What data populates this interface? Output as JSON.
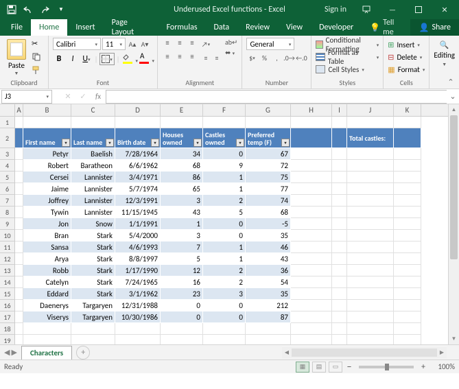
{
  "title": "Underused Excel functions - Excel",
  "signin": "Sign in",
  "tabs": {
    "file": "File",
    "home": "Home",
    "insert": "Insert",
    "pagelayout": "Page Layout",
    "formulas": "Formulas",
    "data": "Data",
    "review": "Review",
    "view": "View",
    "developer": "Developer",
    "tellme": "Tell me",
    "share": "Share"
  },
  "ribbon": {
    "clipboard": {
      "paste": "Paste",
      "label": "Clipboard"
    },
    "font": {
      "name": "Calibri",
      "size": "11",
      "label": "Font"
    },
    "alignment": {
      "label": "Alignment"
    },
    "number": {
      "format": "General",
      "label": "Number"
    },
    "styles": {
      "conditional": "Conditional Formatting",
      "table": "Format as Table",
      "cellstyles": "Cell Styles",
      "label": "Styles"
    },
    "cells": {
      "insert": "Insert",
      "delete": "Delete",
      "format": "Format",
      "label": "Cells"
    },
    "editing": {
      "label": "Editing"
    }
  },
  "namebox": "J3",
  "formula": "",
  "columns": [
    "A",
    "B",
    "C",
    "D",
    "E",
    "F",
    "G",
    "H",
    "I",
    "J",
    "K"
  ],
  "rows": [
    "1",
    "2",
    "3",
    "4",
    "5",
    "6",
    "7",
    "8",
    "9",
    "10",
    "11",
    "12",
    "13",
    "14",
    "15",
    "16",
    "17",
    "18",
    "19"
  ],
  "extra_label": "Total castles:",
  "table": {
    "headers": [
      "First name",
      "Last name",
      "Birth date",
      "Houses owned",
      "Castles owned",
      "Preferred temp (F)"
    ],
    "rows": [
      {
        "first": "Petyr",
        "last": "Baelish",
        "birth": "7/28/1964",
        "houses": "34",
        "castles": "0",
        "temp": "67"
      },
      {
        "first": "Robert",
        "last": "Baratheon",
        "birth": "6/6/1962",
        "houses": "68",
        "castles": "9",
        "temp": "72"
      },
      {
        "first": "Cersei",
        "last": "Lannister",
        "birth": "3/4/1971",
        "houses": "86",
        "castles": "1",
        "temp": "75"
      },
      {
        "first": "Jaime",
        "last": "Lannister",
        "birth": "5/7/1974",
        "houses": "65",
        "castles": "1",
        "temp": "77"
      },
      {
        "first": "Joffrey",
        "last": "Lannister",
        "birth": "12/3/1991",
        "houses": "3",
        "castles": "2",
        "temp": "74"
      },
      {
        "first": "Tywin",
        "last": "Lannister",
        "birth": "11/15/1945",
        "houses": "43",
        "castles": "5",
        "temp": "68"
      },
      {
        "first": "Jon",
        "last": "Snow",
        "birth": "1/1/1991",
        "houses": "1",
        "castles": "0",
        "temp": "-5"
      },
      {
        "first": "Bran",
        "last": "Stark",
        "birth": "5/4/2000",
        "houses": "3",
        "castles": "0",
        "temp": "35"
      },
      {
        "first": "Sansa",
        "last": "Stark",
        "birth": "4/6/1993",
        "houses": "7",
        "castles": "1",
        "temp": "46"
      },
      {
        "first": "Arya",
        "last": "Stark",
        "birth": "8/8/1997",
        "houses": "5",
        "castles": "1",
        "temp": "43"
      },
      {
        "first": "Robb",
        "last": "Stark",
        "birth": "1/17/1990",
        "houses": "12",
        "castles": "2",
        "temp": "36"
      },
      {
        "first": "Catelyn",
        "last": "Stark",
        "birth": "7/24/1965",
        "houses": "16",
        "castles": "2",
        "temp": "54"
      },
      {
        "first": "Eddard",
        "last": "Stark",
        "birth": "3/1/1962",
        "houses": "23",
        "castles": "3",
        "temp": "35"
      },
      {
        "first": "Daenerys",
        "last": "Targaryen",
        "birth": "12/31/1988",
        "houses": "0",
        "castles": "0",
        "temp": "212"
      },
      {
        "first": "Viserys",
        "last": "Targaryen",
        "birth": "10/30/1986",
        "houses": "0",
        "castles": "0",
        "temp": "87"
      }
    ]
  },
  "sheet_tab": "Characters",
  "status": {
    "ready": "Ready",
    "zoom": "100%"
  }
}
